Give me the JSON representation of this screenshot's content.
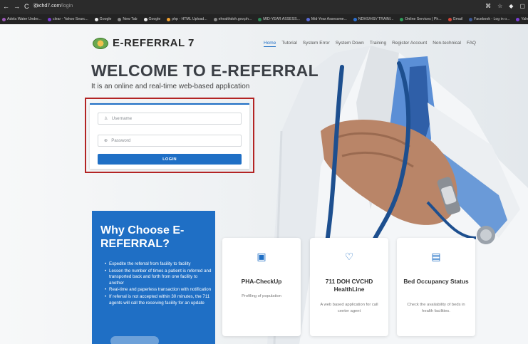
{
  "browser": {
    "url_host": "cvchd7.com",
    "url_path": "/login",
    "bookmarks": [
      {
        "label": "Adela Water Under...",
        "color": "#9b59b6"
      },
      {
        "label": "clear - Yahoo Searc...",
        "color": "#7b3fd4"
      },
      {
        "label": "Google",
        "color": "#e8e8e8"
      },
      {
        "label": "New Tab",
        "color": "#888888"
      },
      {
        "label": "Google",
        "color": "#e8e8e8"
      },
      {
        "label": "php - HTML Upload...",
        "color": "#f0a030"
      },
      {
        "label": "ehealthdoh.gov.ph...",
        "color": "#888888"
      },
      {
        "label": "MID-YEAR ASSESS...",
        "color": "#2e8b57"
      },
      {
        "label": "Mid-Year Assessme...",
        "color": "#5b6bd6"
      },
      {
        "label": "NDHS/HSV TRAINI...",
        "color": "#2a6fd0"
      },
      {
        "label": "Online Services | Ph...",
        "color": "#2e9b57"
      },
      {
        "label": "Gmail",
        "color": "#d44638"
      },
      {
        "label": "Facebook - Log in o...",
        "color": "#3b5998"
      },
      {
        "label": "Yahoo Gro",
        "color": "#7b3fd4"
      }
    ]
  },
  "header": {
    "logo_text": "E-REFERRAL 7",
    "nav": [
      "Home",
      "Tutorial",
      "System Error",
      "System Down",
      "Training",
      "Register Account",
      "Non-technical",
      "FAQ"
    ]
  },
  "hero": {
    "title": "WELCOME TO E-REFERRAL",
    "tagline": "It is an online and real-time web-based application"
  },
  "login": {
    "username_placeholder": "Username",
    "password_placeholder": "Password",
    "button_label": "LOGIN"
  },
  "why": {
    "title": "Why Choose E-REFERRAL?",
    "points": [
      "Expedite the referral from facility to facility",
      "Lessen the number of times a patient is referred and transported back and forth from one facility to another",
      "Real-time and paperless transaction with notification",
      "If referral is not accepted within 30 minutes, the 711 agents will call the receiving facility for an update"
    ]
  },
  "features": [
    {
      "icon": "clipboard-icon",
      "glyph": "▣",
      "title": "PHA-CheckUp",
      "desc": "Profiling of population"
    },
    {
      "icon": "heart-icon",
      "glyph": "♡",
      "title": "711 DOH CVCHD HealthLine",
      "desc": "A web based application for call center agent"
    },
    {
      "icon": "monitor-icon",
      "glyph": "▤",
      "title": "Bed Occupancy Status",
      "desc": "Check the availability of beds in health facilities."
    }
  ],
  "colors": {
    "accent": "#1f6fc5",
    "highlight_border": "#b32424"
  }
}
